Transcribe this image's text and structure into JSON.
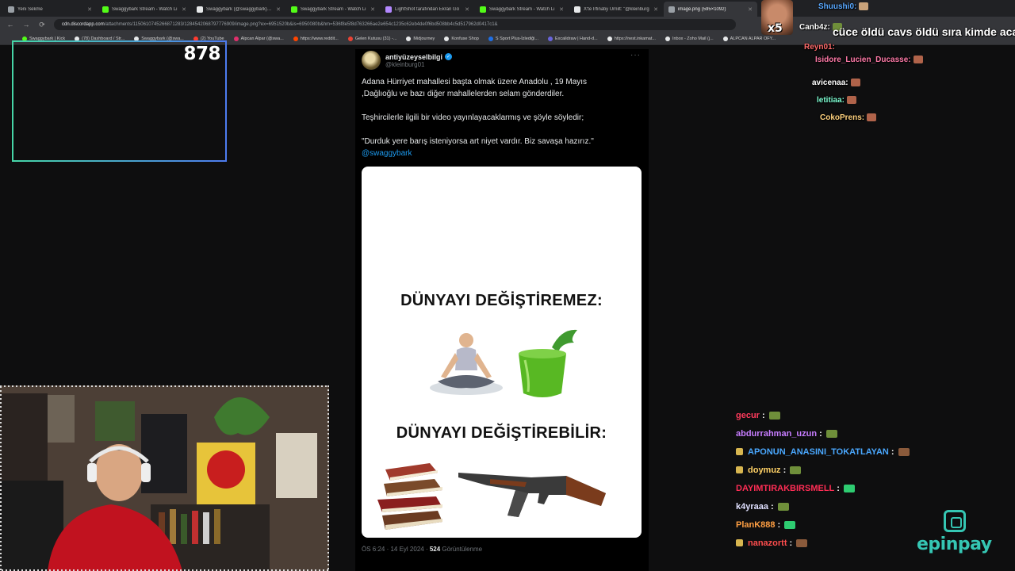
{
  "browser": {
    "tabs": [
      {
        "title": "Yeni Sekme",
        "color": "#9aa0a6",
        "active": false
      },
      {
        "title": "Swaggybark Stream - Watch Li",
        "color": "#53fc18",
        "active": false
      },
      {
        "title": "Swaggybark (@swaggybark) / X",
        "color": "#e7e9ea",
        "active": false
      },
      {
        "title": "Swaggybark Stream - Watch Li",
        "color": "#53fc18",
        "active": false
      },
      {
        "title": "LightShot tarafından Ekran Gö",
        "color": "#b388ff",
        "active": false
      },
      {
        "title": "Swaggybark Stream - Watch Li",
        "color": "#53fc18",
        "active": false
      },
      {
        "title": "X'te İrfinatiy Ürnilt: \"@kleinburg",
        "color": "#e7e9ea",
        "active": false
      },
      {
        "title": "image.png (595×1092)",
        "color": "#9aa0a6",
        "active": true
      }
    ],
    "url_host": "cdn.discordapp.com",
    "url_path": "/attachments/1150610745266871283/1284542068797776909/image.png?ex=6951520b&is=6950080b&hm=536f8e5f8d763266ae2e654c1235c62eb4de0f6bd508bb4c5d517962d0417c1&",
    "bookmarks": [
      {
        "label": "Swaggybark | Kick",
        "color": "#53fc18"
      },
      {
        "label": "(78) Dashboard / Str...",
        "color": "#e7e9ea"
      },
      {
        "label": "Swaggybark (@swa...",
        "color": "#e7e9ea"
      },
      {
        "label": "(2) YouTube",
        "color": "#ff3b30"
      },
      {
        "label": "Alpcan Alpar (@swa...",
        "color": "#e1306c"
      },
      {
        "label": "https://www.reddit...",
        "color": "#ff4500"
      },
      {
        "label": "Gelen Kutusu (31) -...",
        "color": "#ea4335"
      },
      {
        "label": "Midjourney",
        "color": "#e7e9ea"
      },
      {
        "label": "Konfuse Shop",
        "color": "#e7e9ea"
      },
      {
        "label": "S Sport Plus-İzlediği...",
        "color": "#1f6fe5"
      },
      {
        "label": "Excalidraw | Hand-d...",
        "color": "#6965db"
      },
      {
        "label": "https://nest.inkamat...",
        "color": "#e7e9ea"
      },
      {
        "label": "Inbox - Zoho Mail (j...",
        "color": "#e7e9ea"
      },
      {
        "label": "ALPCAN ALPAR OFY...",
        "color": "#e7e9ea"
      }
    ]
  },
  "overlay": {
    "counter": "878"
  },
  "tweet": {
    "name": "antiyüzeyselbilgi",
    "handle": "@kleinburg01",
    "body_1a": "Adana Hürriyet mahallesi başta olmak üzere Anadolu , 19 Mayıs",
    "body_1b": ",Dağlıoğlu ve bazı diğer mahallelerden selam gönderdiler.",
    "body_2": "Teşhircilerle ilgili bir video yayınlayacaklarmış ve şöyle söyledir;",
    "body_3": "\"Durduk yere barış isteniyorsa art niyet vardır. Biz savaşa hazırız.\"",
    "mention": "@swaggybark",
    "meme_top": "DÜNYAYI DEĞİŞTİREMEZ:",
    "meme_bottom": "DÜNYAYI DEĞİŞTİREBİLİR:",
    "time": "ÖS 6:24 · 14 Eyl 2024 · ",
    "views": "524",
    "views_label": " Görüntülenme",
    "more_icon": "ellipsis-icon"
  },
  "chat_top": [
    {
      "user": "Shuushi0:",
      "msg": "",
      "color": "#5aa9ff",
      "emote": "#c9a27a"
    },
    {
      "user": "Canb4z:",
      "msg": "",
      "color": "#ffffff",
      "emote": "#6f8f3a"
    },
    {
      "user": "",
      "msg": "cüce öldü cavs öldü sıra kimde acab",
      "color": "#ffffff",
      "emote": ""
    },
    {
      "user": "Reyn01:",
      "msg": "",
      "color": "#ff6b6b",
      "emote": ""
    },
    {
      "user": "Isidore_Lucien_Ducasse:",
      "msg": "",
      "color": "#ff7aa8",
      "emote": "#b0634a"
    },
    {
      "user": "avicenaa:",
      "msg": "",
      "color": "#ffffff",
      "emote": "#b0634a"
    },
    {
      "user": "letitiaa:",
      "msg": "",
      "color": "#7fffd4",
      "emote": "#b0634a"
    },
    {
      "user": "CokoPrens:",
      "msg": "",
      "color": "#ffd27f",
      "emote": "#b0634a"
    }
  ],
  "chat_bottom": [
    {
      "user": "gecur",
      "color": "#ff3b5c",
      "emote": "#6f8f3a",
      "badge": false
    },
    {
      "user": "abdurrahman_uzun",
      "color": "#c77dff",
      "emote": "#6f8f3a",
      "badge": false
    },
    {
      "user": "APONUN_ANASINI_TOKATLAYAN",
      "color": "#4aa8ff",
      "emote": "#8a5a3b",
      "badge": true
    },
    {
      "user": "doymuz",
      "color": "#ffd166",
      "emote": "#6f8f3a",
      "badge": true
    },
    {
      "user": "DAYIMTIRAKBIRSMELL",
      "color": "#ff2d55",
      "emote": "#2ecc71",
      "badge": false
    },
    {
      "user": "k4yraaa",
      "color": "#e0e0ff",
      "emote": "#6f8f3a",
      "badge": false
    },
    {
      "user": "PlanK888",
      "color": "#ff9f43",
      "emote": "#2ecc71",
      "badge": false
    },
    {
      "user": "nanazortt",
      "color": "#ff4d4d",
      "emote": "#8a5a3b",
      "badge": true
    }
  ],
  "sponsor": {
    "name": "epinpay",
    "color": "#35c6b3"
  }
}
